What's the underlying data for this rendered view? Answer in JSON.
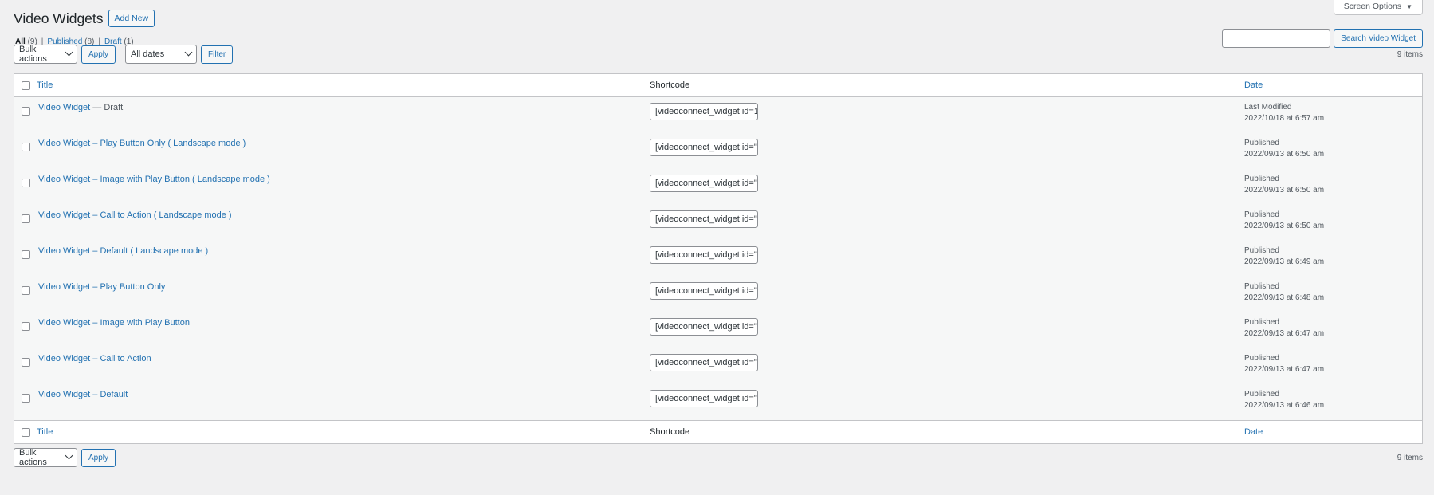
{
  "screen_options": {
    "label": "Screen Options",
    "caret": "▼"
  },
  "header": {
    "title": "Video Widgets",
    "add_new": "Add New"
  },
  "views": [
    {
      "label": "All",
      "count": "(9)"
    },
    {
      "label": "Published",
      "count": "(8)"
    },
    {
      "label": "Draft",
      "count": "(1)"
    }
  ],
  "search": {
    "value": "",
    "button": "Search Video Widget"
  },
  "top_nav": {
    "bulk_actions": "Bulk actions",
    "apply": "Apply",
    "dates": "All dates",
    "filter": "Filter",
    "items": "9 items"
  },
  "bottom_nav": {
    "bulk_actions": "Bulk actions",
    "apply": "Apply",
    "items": "9 items"
  },
  "columns": {
    "title": "Title",
    "shortcode": "Shortcode",
    "date": "Date"
  },
  "rows": [
    {
      "title": "Video Widget",
      "state": " — Draft",
      "shortcode": "[videoconnect_widget id=1",
      "status": "Last Modified",
      "date": "2022/10/18 at 6:57 am"
    },
    {
      "title": "Video Widget – Play Button Only ( Landscape mode )",
      "state": "",
      "shortcode": "[videoconnect_widget id=\"",
      "status": "Published",
      "date": "2022/09/13 at 6:50 am"
    },
    {
      "title": "Video Widget – Image with Play Button ( Landscape mode )",
      "state": "",
      "shortcode": "[videoconnect_widget id=\"",
      "status": "Published",
      "date": "2022/09/13 at 6:50 am"
    },
    {
      "title": "Video Widget – Call to Action ( Landscape mode )",
      "state": "",
      "shortcode": "[videoconnect_widget id=\"",
      "status": "Published",
      "date": "2022/09/13 at 6:50 am"
    },
    {
      "title": "Video Widget – Default ( Landscape mode )",
      "state": "",
      "shortcode": "[videoconnect_widget id=\"",
      "status": "Published",
      "date": "2022/09/13 at 6:49 am"
    },
    {
      "title": "Video Widget – Play Button Only",
      "state": "",
      "shortcode": "[videoconnect_widget id=\"",
      "status": "Published",
      "date": "2022/09/13 at 6:48 am"
    },
    {
      "title": "Video Widget – Image with Play Button",
      "state": "",
      "shortcode": "[videoconnect_widget id=\"",
      "status": "Published",
      "date": "2022/09/13 at 6:47 am"
    },
    {
      "title": "Video Widget – Call to Action",
      "state": "",
      "shortcode": "[videoconnect_widget id=\"",
      "status": "Published",
      "date": "2022/09/13 at 6:47 am"
    },
    {
      "title": "Video Widget – Default",
      "state": "",
      "shortcode": "[videoconnect_widget id=\"",
      "status": "Published",
      "date": "2022/09/13 at 6:46 am"
    }
  ]
}
